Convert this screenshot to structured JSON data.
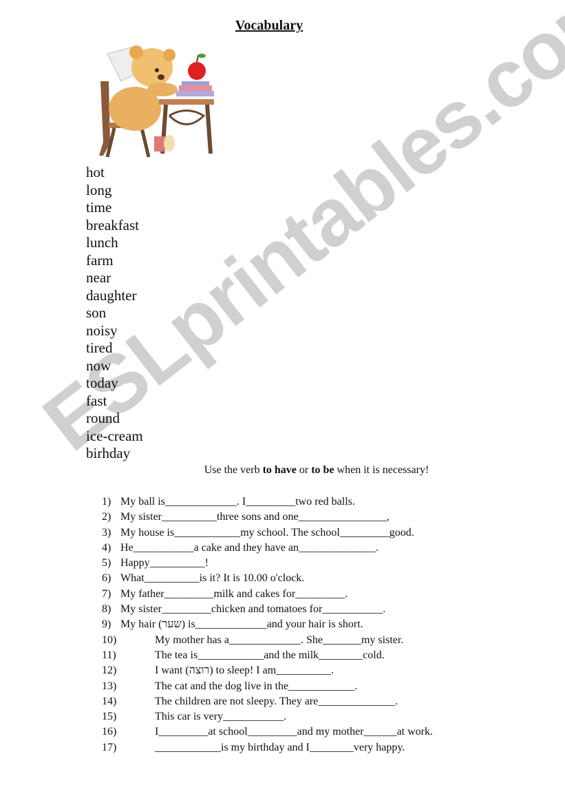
{
  "title": "Vocabulary",
  "clipart": {
    "description": "teddy-bear-at-school-desk",
    "icon": "teddy-bear-icon"
  },
  "vocabulary": [
    "hot",
    "long",
    "time",
    "breakfast",
    "lunch",
    "farm",
    "near",
    "daughter",
    "son",
    "noisy",
    "tired",
    "now",
    "today",
    "fast",
    "round",
    "ice-cream",
    "birhday"
  ],
  "instruction": {
    "part1": "Use the verb ",
    "bold1": "to have",
    "part2": " or ",
    "bold2": "to be",
    "part3": " when it is necessary!"
  },
  "exercises": [
    {
      "num": "1)",
      "text": "My ball is_____________. I_________two red balls."
    },
    {
      "num": "2)",
      "text": "My sister__________three sons and one________________,"
    },
    {
      "num": "3)",
      "text": "My house is____________my school. The school_________good."
    },
    {
      "num": "4)",
      "text": "He___________a cake and they have an______________."
    },
    {
      "num": "5)",
      "text": "Happy__________!"
    },
    {
      "num": "6)",
      "text": "What__________is it? It is 10.00 o'clock."
    },
    {
      "num": "7)",
      "text": "My father_________milk and cakes for_________."
    },
    {
      "num": "8)",
      "text": "My sister_________chicken and tomatoes for___________."
    },
    {
      "num": "9)",
      "text": "My hair (שער) is_____________and your hair is short."
    },
    {
      "num": "10)",
      "text": "My mother has a_____________. She_______my sister."
    },
    {
      "num": "11)",
      "text": "The tea is____________and the milk________cold."
    },
    {
      "num": "12)",
      "text": "I want (רוצה) to sleep! I am__________."
    },
    {
      "num": "13)",
      "text": "The cat and the dog live in the____________."
    },
    {
      "num": "14)",
      "text": "The children are not sleepy. They are______________."
    },
    {
      "num": "15)",
      "text": "This car is very___________."
    },
    {
      "num": "16)",
      "text": "I_________at school_________and my mother______at work."
    },
    {
      "num": "17)",
      "text": "____________is my birthday and I________very happy."
    }
  ],
  "watermark": "ESLprintables.com"
}
